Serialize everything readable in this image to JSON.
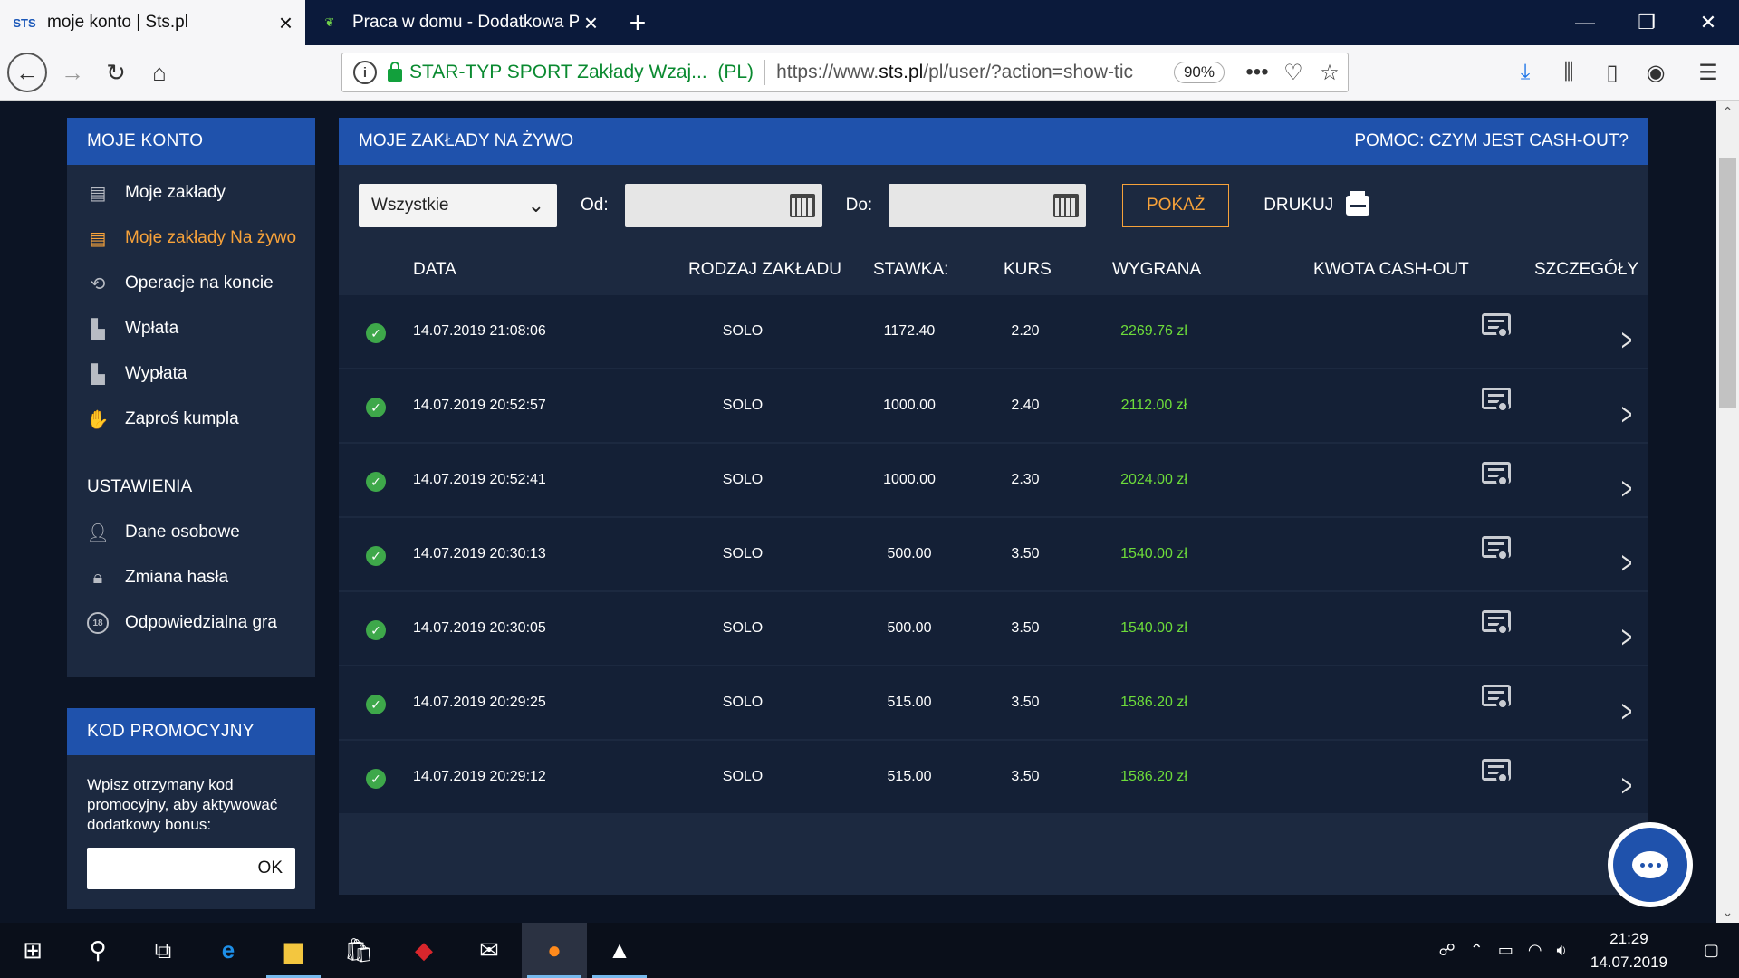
{
  "browser": {
    "tabs": [
      {
        "favicon": "STS",
        "title": "moje konto | Sts.pl",
        "active": true
      },
      {
        "favicon": "leaf-icon",
        "title": "Praca w domu - Dodatkowa Pr",
        "active": false
      }
    ],
    "url": {
      "org": "STAR-TYP SPORT Zakłady Wzaj...",
      "country": "(PL)",
      "prefix": "https://www.",
      "domain": "sts.pl",
      "path": "/pl/user/?action=show-tic",
      "zoom": "90%"
    }
  },
  "sidebar": {
    "account_title": "MOJE KONTO",
    "account_items": [
      {
        "label": "Moje zakłady",
        "icon": "list-icon",
        "active": false
      },
      {
        "label": "Moje zakłady Na żywo",
        "icon": "list-icon",
        "active": true
      },
      {
        "label": "Operacje na koncie",
        "icon": "history-icon",
        "active": false
      },
      {
        "label": "Wpłata",
        "icon": "wallet-in-icon",
        "active": false
      },
      {
        "label": "Wypłata",
        "icon": "wallet-out-icon",
        "active": false
      },
      {
        "label": "Zaproś kumpla",
        "icon": "handshake-icon",
        "active": false
      }
    ],
    "settings_title": "USTAWIENIA",
    "settings_items": [
      {
        "label": "Dane osobowe",
        "icon": "person-icon"
      },
      {
        "label": "Zmiana hasła",
        "icon": "lock-icon"
      },
      {
        "label": "Odpowiedzialna gra",
        "icon": "age-18-icon"
      }
    ],
    "promo": {
      "title": "KOD PROMOCYJNY",
      "text": "Wpisz otrzymany kod promocyjny, aby aktywować dodatkowy bonus:",
      "button": "OK"
    }
  },
  "main": {
    "title": "MOJE ZAKŁADY NA ŻYWO",
    "help": "POMOC: CZYM JEST CASH-OUT?",
    "filters": {
      "select_value": "Wszystkie",
      "from_label": "Od:",
      "to_label": "Do:",
      "show_button": "POKAŻ",
      "print_label": "DRUKUJ"
    },
    "columns": [
      "DATA",
      "RODZAJ ZAKŁADU",
      "STAWKA:",
      "KURS",
      "WYGRANA",
      "KWOTA CASH-OUT",
      "SZCZEGÓŁY"
    ],
    "rows": [
      {
        "date": "14.07.2019 21:08:06",
        "type": "SOLO",
        "stake": "1172.40",
        "odds": "2.20",
        "win": "2269.76 zł"
      },
      {
        "date": "14.07.2019 20:52:57",
        "type": "SOLO",
        "stake": "1000.00",
        "odds": "2.40",
        "win": "2112.00 zł"
      },
      {
        "date": "14.07.2019 20:52:41",
        "type": "SOLO",
        "stake": "1000.00",
        "odds": "2.30",
        "win": "2024.00 zł"
      },
      {
        "date": "14.07.2019 20:30:13",
        "type": "SOLO",
        "stake": "500.00",
        "odds": "3.50",
        "win": "1540.00 zł"
      },
      {
        "date": "14.07.2019 20:30:05",
        "type": "SOLO",
        "stake": "500.00",
        "odds": "3.50",
        "win": "1540.00 zł"
      },
      {
        "date": "14.07.2019 20:29:25",
        "type": "SOLO",
        "stake": "515.00",
        "odds": "3.50",
        "win": "1586.20 zł"
      },
      {
        "date": "14.07.2019 20:29:12",
        "type": "SOLO",
        "stake": "515.00",
        "odds": "3.50",
        "win": "1586.20 zł"
      }
    ]
  },
  "taskbar": {
    "time": "21:29",
    "date": "14.07.2019"
  },
  "colors": {
    "accent": "#1f52ac",
    "active": "#f7a23a",
    "win": "#6ddc3a",
    "panel": "#1c2940",
    "background": "#0c1424"
  }
}
